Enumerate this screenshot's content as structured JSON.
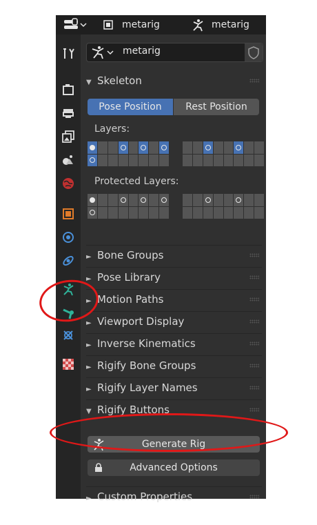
{
  "header": {
    "object_name": "metarig",
    "armature_name": "metarig"
  },
  "data_name_field": {
    "value": "metarig"
  },
  "skeleton": {
    "title": "Skeleton",
    "pose_position_label": "Pose Position",
    "rest_position_label": "Rest Position",
    "layers_label": "Layers:",
    "protected_layers_label": "Protected Layers:"
  },
  "sections": [
    {
      "label": "Bone Groups",
      "expanded": false
    },
    {
      "label": "Pose Library",
      "expanded": false
    },
    {
      "label": "Motion Paths",
      "expanded": false
    },
    {
      "label": "Viewport Display",
      "expanded": false
    },
    {
      "label": "Inverse Kinematics",
      "expanded": false
    },
    {
      "label": "Rigify Bone Groups",
      "expanded": false
    },
    {
      "label": "Rigify Layer Names",
      "expanded": false
    },
    {
      "label": "Rigify Buttons",
      "expanded": true
    }
  ],
  "rigify_buttons": {
    "generate_label": "Generate Rig",
    "advanced_label": "Advanced Options"
  },
  "custom_properties": {
    "label": "Custom Properties"
  },
  "tabs": [
    "tool-tab",
    "render-tab",
    "output-tab",
    "view-layer-tab",
    "scene-tab",
    "world-tab",
    "object-tab",
    "modifiers-tab",
    "physics-tab",
    "object-data-armature-tab",
    "bone-tab",
    "bone-constraints-tab",
    "texture-tab"
  ],
  "colors": {
    "accent": "#4772b3",
    "annotation": "#e01818",
    "armature_tab": "#2fb39a"
  }
}
